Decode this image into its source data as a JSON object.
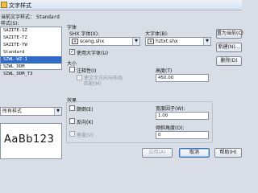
{
  "window": {
    "title": "文字样式"
  },
  "current_style": {
    "label": "当前文字样式：",
    "value": "Standard"
  },
  "styles_label": "样式(S):",
  "styles": [
    {
      "name": "SAZITE-SZ",
      "selected": false
    },
    {
      "name": "SAZITE-TZ",
      "selected": false
    },
    {
      "name": "SAZITE-YW",
      "selected": false
    },
    {
      "name": "Standard",
      "selected": false
    },
    {
      "name": "SZWL-WZ-1",
      "selected": true
    },
    {
      "name": "SZWL_DDM",
      "selected": false
    },
    {
      "name": "SZWL_DDM_T3",
      "selected": false
    }
  ],
  "filter_label": "所有样式",
  "font_section": {
    "title": "字体",
    "shx_label": "SHX 字体(X):",
    "shx_value": "sceng.shx",
    "big_label": "大字体(B):",
    "big_value": "hztxt.shx",
    "use_big_font": {
      "label": "使用大字体(U)",
      "checked": true
    }
  },
  "size_section": {
    "title": "大小",
    "annotative": {
      "label": "注释性(I)",
      "checked": false
    },
    "match_orientation": {
      "label": "使文字方向与布局",
      "label2": "匹配(M)",
      "checked": false
    },
    "height_label": "高度(T)",
    "height_value": "450.00"
  },
  "effects_section": {
    "title": "效果",
    "upside_down": {
      "label": "颠倒(E)",
      "checked": false
    },
    "backwards": {
      "label": "反向(K)",
      "checked": false
    },
    "vertical": {
      "label": "垂直(V)",
      "checked": false
    },
    "width_factor_label": "宽度因子(W):",
    "width_factor_value": "1.00",
    "oblique_label": "倾斜角度(O):",
    "oblique_value": "0"
  },
  "preview_text": "AaBb123",
  "buttons": {
    "set_current": "置为当前(C)",
    "new": "新建(N)...",
    "delete": "删除(D)",
    "apply": "应用(A)",
    "cancel": "取消",
    "help": "帮助(H)"
  }
}
